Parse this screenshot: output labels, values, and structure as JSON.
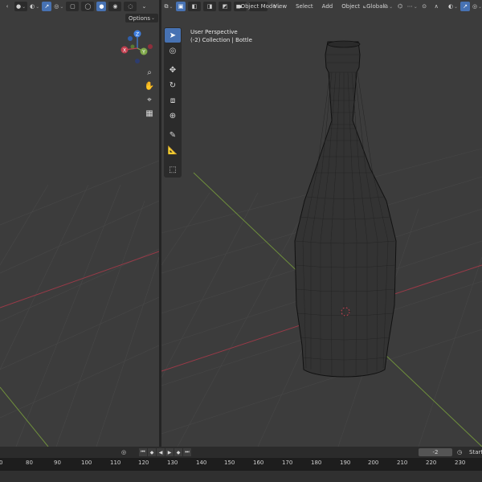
{
  "left_viewport": {
    "options_label": "Options",
    "gizmo": {
      "z": "Z",
      "x": "X",
      "y": "Y"
    }
  },
  "right_viewport": {
    "mode_label": "Object Mode",
    "menus": [
      "View",
      "Select",
      "Add",
      "Object"
    ],
    "transform_orientation": "Global",
    "overlay_line1": "User Perspective",
    "overlay_line2": "(-2) Collection | Bottle"
  },
  "timeline": {
    "current_frame": "-2",
    "start_label": "Start",
    "ruler_ticks": [
      "0",
      "80",
      "90",
      "100",
      "110",
      "120",
      "130",
      "140",
      "150",
      "160",
      "170",
      "180",
      "190",
      "200",
      "210",
      "220",
      "230"
    ]
  },
  "colors": {
    "accent": "#4772b3",
    "x_axis": "#c24050",
    "y_axis": "#7fa84a",
    "z_axis": "#3f7fe0"
  }
}
